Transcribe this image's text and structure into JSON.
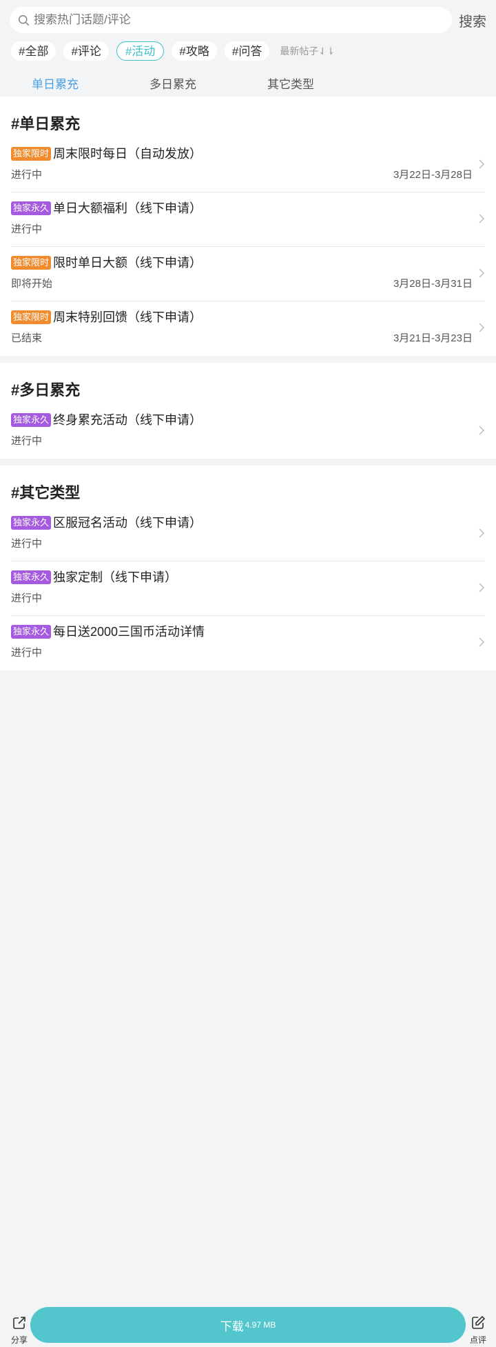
{
  "search": {
    "placeholder": "搜索热门话题/评论",
    "button": "搜索"
  },
  "chips": [
    "#全部",
    "#评论",
    "#活动",
    "#攻略",
    "#问答"
  ],
  "sort_label": "最新帖子⇃⇂",
  "tabs": [
    "单日累充",
    "多日累充",
    "其它类型"
  ],
  "sections": [
    {
      "title": "#单日累充",
      "items": [
        {
          "badge": "独家限时",
          "title": "周末限时每日（自动发放）",
          "status": "进行中",
          "date": "3月22日-3月28日"
        },
        {
          "badge": "独家永久",
          "title": "单日大额福利（线下申请）",
          "status": "进行中",
          "date": ""
        },
        {
          "badge": "独家限时",
          "title": "限时单日大额（线下申请）",
          "status": "即将开始",
          "date": "3月28日-3月31日"
        },
        {
          "badge": "独家限时",
          "title": "周末特别回馈（线下申请）",
          "status": "已结束",
          "date": "3月21日-3月23日"
        }
      ]
    },
    {
      "title": "#多日累充",
      "items": [
        {
          "badge": "独家永久",
          "title": "终身累充活动（线下申请）",
          "status": "进行中",
          "date": ""
        }
      ]
    },
    {
      "title": "#其它类型",
      "items": [
        {
          "badge": "独家永久",
          "title": "区服冠名活动（线下申请）",
          "status": "进行中",
          "date": ""
        },
        {
          "badge": "独家永久",
          "title": "独家定制（线下申请）",
          "status": "进行中",
          "date": ""
        },
        {
          "badge": "独家永久",
          "title": "每日送2000三国币活动详情",
          "status": "进行中",
          "date": ""
        }
      ]
    }
  ],
  "bottom": {
    "share": "分享",
    "download_label": "下载",
    "download_size": "4.97 MB",
    "review": "点评"
  },
  "colors": {
    "accent": "#3fc1c9",
    "tab_active": "#4aa0e6",
    "badge_limited": "#f08c2e",
    "badge_forever": "#a55be0",
    "download": "#53c6cd"
  }
}
